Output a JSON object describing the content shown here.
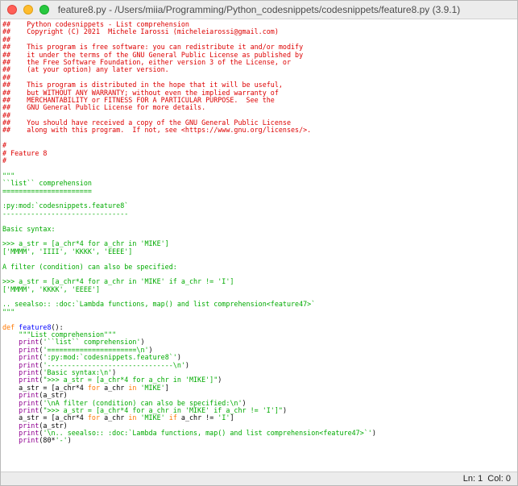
{
  "window": {
    "title": "feature8.py - /Users/miia/Programming/Python_codesnippets/codesnippets/feature8.py (3.9.1)"
  },
  "status": {
    "line": "Ln: 1",
    "col": "Col: 0"
  },
  "colors": {
    "comment": "#dd0000",
    "string": "#00aa00",
    "keyword": "#ff7700",
    "definition": "#0000ff",
    "builtin": "#900090"
  },
  "code": {
    "lines": [
      [
        [
          "cm",
          "##    Python codesnippets - List comprehension"
        ]
      ],
      [
        [
          "cm",
          "##    Copyright (C) 2021  Michele Iarossi (micheleiarossi@gmail.com)"
        ]
      ],
      [
        [
          "cm",
          "##"
        ]
      ],
      [
        [
          "cm",
          "##    This program is free software: you can redistribute it and/or modify"
        ]
      ],
      [
        [
          "cm",
          "##    it under the terms of the GNU General Public License as published by"
        ]
      ],
      [
        [
          "cm",
          "##    the Free Software Foundation, either version 3 of the License, or"
        ]
      ],
      [
        [
          "cm",
          "##    (at your option) any later version."
        ]
      ],
      [
        [
          "cm",
          "##"
        ]
      ],
      [
        [
          "cm",
          "##    This program is distributed in the hope that it will be useful,"
        ]
      ],
      [
        [
          "cm",
          "##    but WITHOUT ANY WARRANTY; without even the implied warranty of"
        ]
      ],
      [
        [
          "cm",
          "##    MERCHANTABILITY or FITNESS FOR A PARTICULAR PURPOSE.  See the"
        ]
      ],
      [
        [
          "cm",
          "##    GNU General Public License for more details."
        ]
      ],
      [
        [
          "cm",
          "##"
        ]
      ],
      [
        [
          "cm",
          "##    You should have received a copy of the GNU General Public License"
        ]
      ],
      [
        [
          "cm",
          "##    along with this program.  If not, see <https://www.gnu.org/licenses/>."
        ]
      ],
      [],
      [
        [
          "cm",
          "#"
        ]
      ],
      [
        [
          "cm",
          "# Feature 8"
        ]
      ],
      [
        [
          "cm",
          "#"
        ]
      ],
      [],
      [
        [
          "st",
          "\"\"\""
        ]
      ],
      [
        [
          "st",
          "``list`` comprehension"
        ]
      ],
      [
        [
          "st",
          "======================"
        ]
      ],
      [],
      [
        [
          "st",
          ":py:mod:`codesnippets.feature8`"
        ]
      ],
      [
        [
          "st",
          "-------------------------------"
        ]
      ],
      [],
      [
        [
          "st",
          "Basic syntax:"
        ]
      ],
      [],
      [
        [
          "st",
          ">>> a_str = [a_chr*4 for a_chr in 'MIKE']"
        ]
      ],
      [
        [
          "st",
          "['MMMM', 'IIII', 'KKKK', 'EEEE']"
        ]
      ],
      [],
      [
        [
          "st",
          "A filter (condition) can also be specified:"
        ]
      ],
      [],
      [
        [
          "st",
          ">>> a_str = [a_chr*4 for a_chr in 'MIKE' if a_chr != 'I']"
        ]
      ],
      [
        [
          "st",
          "['MMMM', 'KKKK', 'EEEE']"
        ]
      ],
      [],
      [
        [
          "st",
          ".. seealso:: :doc:`Lambda functions, map() and list comprehension<feature47>`"
        ]
      ],
      [
        [
          "st",
          "\"\"\""
        ]
      ],
      [],
      [
        [
          "kw",
          "def "
        ],
        [
          "fn",
          "feature8"
        ],
        [
          "",
          "():"
        ]
      ],
      [
        [
          "",
          "    "
        ],
        [
          "st",
          "\"\"\"List comprehension\"\"\""
        ]
      ],
      [
        [
          "",
          "    "
        ],
        [
          "bi",
          "print"
        ],
        [
          "",
          "("
        ],
        [
          "st",
          "'``list`` comprehension'"
        ],
        [
          "",
          ")"
        ]
      ],
      [
        [
          "",
          "    "
        ],
        [
          "bi",
          "print"
        ],
        [
          "",
          "("
        ],
        [
          "st",
          "'======================\\n'"
        ],
        [
          "",
          ")"
        ]
      ],
      [
        [
          "",
          "    "
        ],
        [
          "bi",
          "print"
        ],
        [
          "",
          "("
        ],
        [
          "st",
          "':py:mod:`codesnippets.feature8`'"
        ],
        [
          "",
          ")"
        ]
      ],
      [
        [
          "",
          "    "
        ],
        [
          "bi",
          "print"
        ],
        [
          "",
          "("
        ],
        [
          "st",
          "'-------------------------------\\n'"
        ],
        [
          "",
          ")"
        ]
      ],
      [
        [
          "",
          "    "
        ],
        [
          "bi",
          "print"
        ],
        [
          "",
          "("
        ],
        [
          "st",
          "'Basic syntax:\\n'"
        ],
        [
          "",
          ")"
        ]
      ],
      [
        [
          "",
          "    "
        ],
        [
          "bi",
          "print"
        ],
        [
          "",
          "("
        ],
        [
          "st",
          "\">>> a_str = [a_chr*4 for a_chr in 'MIKE']\""
        ],
        [
          "",
          ")"
        ]
      ],
      [
        [
          "",
          "    a_str = [a_chr*4 "
        ],
        [
          "kw",
          "for"
        ],
        [
          "",
          " a_chr "
        ],
        [
          "kw",
          "in"
        ],
        [
          "",
          " "
        ],
        [
          "st",
          "'MIKE'"
        ],
        [
          "",
          "]"
        ]
      ],
      [
        [
          "",
          "    "
        ],
        [
          "bi",
          "print"
        ],
        [
          "",
          "(a_str)"
        ]
      ],
      [
        [
          "",
          "    "
        ],
        [
          "bi",
          "print"
        ],
        [
          "",
          "("
        ],
        [
          "st",
          "'\\nA filter (condition) can also be specified:\\n'"
        ],
        [
          "",
          ")"
        ]
      ],
      [
        [
          "",
          "    "
        ],
        [
          "bi",
          "print"
        ],
        [
          "",
          "("
        ],
        [
          "st",
          "\">>> a_str = [a_chr*4 for a_chr in 'MIKE' if a_chr != 'I']\""
        ],
        [
          "",
          ")"
        ]
      ],
      [
        [
          "",
          "    a_str = [a_chr*4 "
        ],
        [
          "kw",
          "for"
        ],
        [
          "",
          " a_chr "
        ],
        [
          "kw",
          "in"
        ],
        [
          "",
          " "
        ],
        [
          "st",
          "'MIKE'"
        ],
        [
          "",
          " "
        ],
        [
          "kw",
          "if"
        ],
        [
          "",
          " a_chr != "
        ],
        [
          "st",
          "'I'"
        ],
        [
          "",
          "]"
        ]
      ],
      [
        [
          "",
          "    "
        ],
        [
          "bi",
          "print"
        ],
        [
          "",
          "(a_str)"
        ]
      ],
      [
        [
          "",
          "    "
        ],
        [
          "bi",
          "print"
        ],
        [
          "",
          "("
        ],
        [
          "st",
          "'\\n.. seealso:: :doc:`Lambda functions, map() and list comprehension<feature47>`'"
        ],
        [
          "",
          ")"
        ]
      ],
      [
        [
          "",
          "    "
        ],
        [
          "bi",
          "print"
        ],
        [
          "",
          "(80*"
        ],
        [
          "st",
          "'-'"
        ],
        [
          "",
          ")"
        ]
      ]
    ]
  }
}
